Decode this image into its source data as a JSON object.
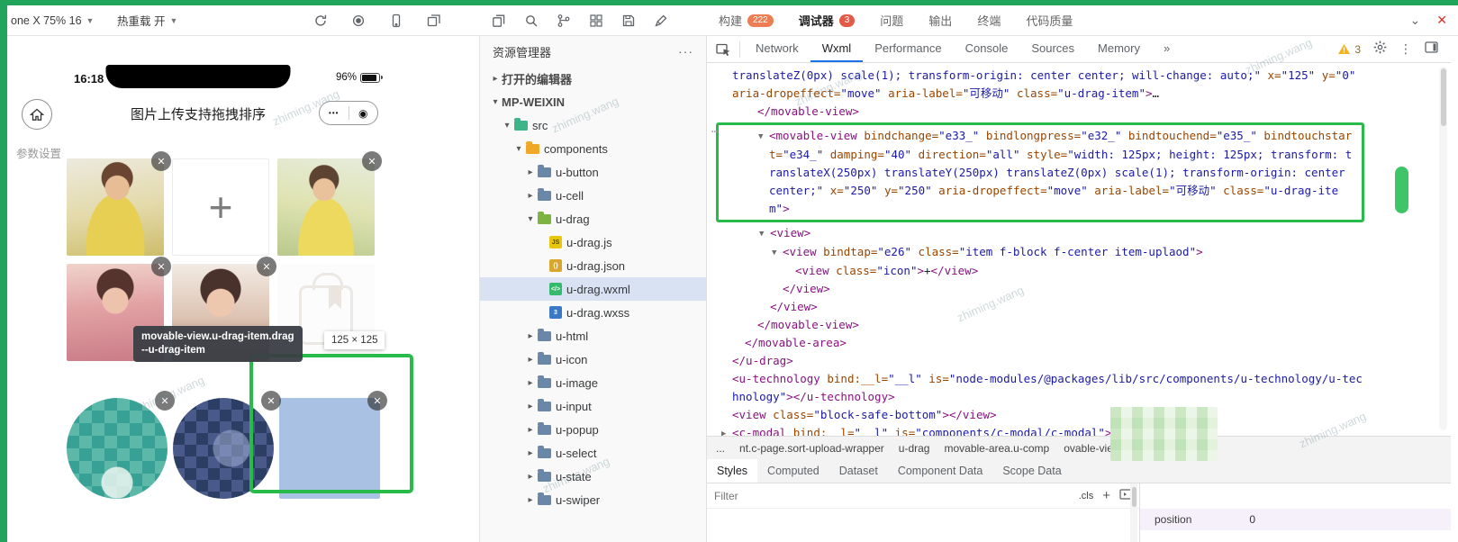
{
  "window_controls": {
    "collapse_glyph": "⌄",
    "close_glyph": "✕"
  },
  "toolbar": {
    "device_selector": "one X 75% 16",
    "hot_reload_label": "热重载 开",
    "icons_group_a": [
      "refresh",
      "record",
      "phone",
      "new-window"
    ],
    "icons_group_b": [
      "copy",
      "search",
      "branch",
      "grid",
      "save",
      "brush"
    ],
    "tabs": [
      {
        "label": "构建",
        "badge": "222",
        "active": false
      },
      {
        "label": "调试器",
        "badge": "3",
        "active": true
      },
      {
        "label": "问题",
        "badge": "",
        "active": false
      },
      {
        "label": "输出",
        "badge": "",
        "active": false
      },
      {
        "label": "终端",
        "badge": "",
        "active": false
      },
      {
        "label": "代码质量",
        "badge": "",
        "active": false
      }
    ]
  },
  "simulator": {
    "status_time": "16:18",
    "battery_percent": "96%",
    "nav_title": "图片上传支持拖拽排序",
    "capsule_more": "•••",
    "capsule_record": "◉",
    "section_label": "参数设置",
    "plus_glyph": "+",
    "close_glyph": "✕",
    "tooltip_line1": "movable-view.u-drag-item.drag",
    "tooltip_line2": "--u-drag-item",
    "size_chip": "125 × 125",
    "grid": [
      {
        "kind": "ph1",
        "close": true
      },
      {
        "kind": "plus",
        "close": false
      },
      {
        "kind": "ph2",
        "close": true
      },
      {
        "kind": "ph3",
        "close": true
      },
      {
        "kind": "ph4",
        "close": true
      },
      {
        "kind": "ghost",
        "close": false
      }
    ],
    "bottom_row": [
      {
        "kind": "mosaic-teal",
        "shape": "circle",
        "close": true
      },
      {
        "kind": "mosaic-navy",
        "shape": "circle",
        "close": true
      },
      {
        "kind": "plain-blue",
        "shape": "square",
        "close": true
      }
    ]
  },
  "explorer": {
    "title": "资源管理器",
    "actions_label": "···",
    "tree": [
      {
        "label": "打开的编辑器",
        "depth": 0,
        "arrow": "right",
        "bold": true
      },
      {
        "label": "MP-WEIXIN",
        "depth": 0,
        "arrow": "down",
        "bold": true
      },
      {
        "label": "src",
        "depth": 1,
        "arrow": "down",
        "icon": "folder-src"
      },
      {
        "label": "components",
        "depth": 2,
        "arrow": "down",
        "icon": "folder-components"
      },
      {
        "label": "u-button",
        "depth": 3,
        "arrow": "right",
        "icon": "folder"
      },
      {
        "label": "u-cell",
        "depth": 3,
        "arrow": "right",
        "icon": "folder"
      },
      {
        "label": "u-drag",
        "depth": 3,
        "arrow": "down",
        "icon": "folder-open"
      },
      {
        "label": "u-drag.js",
        "depth": 4,
        "icon": "js"
      },
      {
        "label": "u-drag.json",
        "depth": 4,
        "icon": "json"
      },
      {
        "label": "u-drag.wxml",
        "depth": 4,
        "icon": "wxml",
        "selected": true
      },
      {
        "label": "u-drag.wxss",
        "depth": 4,
        "icon": "wxss"
      },
      {
        "label": "u-html",
        "depth": 3,
        "arrow": "right",
        "icon": "folder"
      },
      {
        "label": "u-icon",
        "depth": 3,
        "arrow": "right",
        "icon": "folder"
      },
      {
        "label": "u-image",
        "depth": 3,
        "arrow": "right",
        "icon": "folder"
      },
      {
        "label": "u-input",
        "depth": 3,
        "arrow": "right",
        "icon": "folder"
      },
      {
        "label": "u-popup",
        "depth": 3,
        "arrow": "right",
        "icon": "folder"
      },
      {
        "label": "u-select",
        "depth": 3,
        "arrow": "right",
        "icon": "folder"
      },
      {
        "label": "u-state",
        "depth": 3,
        "arrow": "right",
        "icon": "folder"
      },
      {
        "label": "u-swiper",
        "depth": 3,
        "arrow": "right",
        "icon": "folder"
      }
    ]
  },
  "devtools": {
    "tabs": [
      {
        "label": "Network",
        "active": false
      },
      {
        "label": "Wxml",
        "active": true
      },
      {
        "label": "Performance",
        "active": false
      },
      {
        "label": "Console",
        "active": false
      },
      {
        "label": "Sources",
        "active": false
      },
      {
        "label": "Memory",
        "active": false
      },
      {
        "label": "»",
        "active": false
      }
    ],
    "warning_count": "3",
    "code_blocks": [
      {
        "highlight": false,
        "lines": [
          {
            "d": 0,
            "seg": [
              [
                "v",
                "translateZ(0px) scale(1); transform-origin: center center; will-change: auto;\""
              ],
              [
                "at",
                " x="
              ],
              [
                "v",
                "\"125\""
              ],
              [
                "at",
                " y="
              ],
              [
                "v",
                "\"0\""
              ],
              [
                "at",
                " aria-dropeffect="
              ],
              [
                "v",
                "\"move\""
              ],
              [
                "at",
                " aria-label="
              ],
              [
                "v",
                "\"可移动\""
              ],
              [
                "at",
                " class="
              ],
              [
                "v",
                "\"u-drag-item\""
              ],
              [
                "t",
                ">"
              ],
              [
                "p",
                "…"
              ]
            ]
          },
          {
            "d": 2,
            "seg": [
              [
                "t",
                "</movable-view>"
              ]
            ]
          }
        ]
      },
      {
        "highlight": true,
        "lines": [
          {
            "d": 2,
            "seg": [
              [
                "a",
                "▼"
              ],
              [
                "t",
                "<movable-view"
              ],
              [
                "at",
                " bindchange="
              ],
              [
                "v",
                "\"e33_\""
              ],
              [
                "at",
                " bindlongpress="
              ],
              [
                "v",
                "\"e32_\""
              ],
              [
                "at",
                " bindtouchend="
              ],
              [
                "v",
                "\"e35_\""
              ],
              [
                "at",
                " bindtouchstart="
              ],
              [
                "v",
                "\"e34_\""
              ],
              [
                "at",
                " damping="
              ],
              [
                "v",
                "\"40\""
              ],
              [
                "at",
                " direction="
              ],
              [
                "v",
                "\"all\""
              ],
              [
                "at",
                " style="
              ],
              [
                "v",
                "\"width: 125px; height: 125px; transform: translateX(250px) translateY(250px) translateZ(0px) scale(1); transform-origin: center center;\""
              ],
              [
                "at",
                " x="
              ],
              [
                "v",
                "\"250\""
              ],
              [
                "at",
                " y="
              ],
              [
                "v",
                "\"250\""
              ],
              [
                "at",
                " aria-dropeffect="
              ],
              [
                "v",
                "\"move\""
              ],
              [
                "at",
                " aria-label="
              ],
              [
                "v",
                "\"可移动\""
              ],
              [
                "at",
                " class="
              ],
              [
                "v",
                "\"u-drag-item\""
              ],
              [
                "t",
                ">"
              ]
            ]
          }
        ]
      },
      {
        "highlight": false,
        "lines": [
          {
            "d": 3,
            "seg": [
              [
                "a",
                "▼"
              ],
              [
                "t",
                "<view>"
              ]
            ]
          },
          {
            "d": 4,
            "seg": [
              [
                "a",
                "▼"
              ],
              [
                "t",
                "<view"
              ],
              [
                "at",
                " bindtap="
              ],
              [
                "v",
                "\"e26\""
              ],
              [
                "at",
                " class="
              ],
              [
                "v",
                "\"item f-block f-center item-uplaod\""
              ],
              [
                "t",
                ">"
              ]
            ]
          },
          {
            "d": 5,
            "seg": [
              [
                "t",
                "<view"
              ],
              [
                "at",
                " class="
              ],
              [
                "v",
                "\"icon\""
              ],
              [
                "t",
                ">"
              ],
              [
                "p",
                "+"
              ],
              [
                "t",
                "</view>"
              ]
            ]
          },
          {
            "d": 4,
            "seg": [
              [
                "t",
                "</view>"
              ]
            ]
          },
          {
            "d": 3,
            "seg": [
              [
                "t",
                "</view>"
              ]
            ]
          },
          {
            "d": 2,
            "seg": [
              [
                "t",
                "</movable-view>"
              ]
            ]
          },
          {
            "d": 1,
            "seg": [
              [
                "t",
                "</movable-area>"
              ]
            ]
          },
          {
            "d": 0,
            "seg": [
              [
                "t",
                "</u-drag>"
              ]
            ]
          },
          {
            "d": 0,
            "seg": [
              [
                "t",
                "<u-technology"
              ],
              [
                "at",
                " bind:__l="
              ],
              [
                "v",
                "\"__l\""
              ],
              [
                "at",
                " is="
              ],
              [
                "v",
                "\"node-modules/@packages/lib/src/components/u-technology/u-technology\""
              ],
              [
                "t",
                "></u-technology>"
              ]
            ]
          },
          {
            "d": 0,
            "seg": [
              [
                "t",
                "<view"
              ],
              [
                "at",
                " class="
              ],
              [
                "v",
                "\"block-safe-bottom\""
              ],
              [
                "t",
                "></view>"
              ]
            ]
          },
          {
            "d": 0,
            "seg": [
              [
                "a",
                "▶"
              ],
              [
                "t",
                "<c-modal"
              ],
              [
                "at",
                " bind:__l="
              ],
              [
                "v",
                "\"__l\""
              ],
              [
                "at",
                " is="
              ],
              [
                "v",
                "\"components/c-modal/c-modal\""
              ],
              [
                "t",
                ">"
              ],
              [
                "p",
                " "
              ],
              [
                "t",
                "</c-modal>"
              ]
            ]
          }
        ]
      }
    ],
    "breadcrumbs": [
      "...",
      "nt.c-page.sort-upload-wrapper",
      "u-drag",
      "movable-area.u-comp",
      "ovable-view.u-drag-item"
    ],
    "styles_tabs": [
      {
        "label": "Styles",
        "active": true
      },
      {
        "label": "Computed",
        "active": false
      },
      {
        "label": "Dataset",
        "active": false
      },
      {
        "label": "Component Data",
        "active": false
      },
      {
        "label": "Scope Data",
        "active": false
      }
    ],
    "filter_placeholder": "Filter",
    "cls_label": ".cls",
    "plus_label": "+",
    "layout_pane": {
      "rows": [
        {
          "label": "position",
          "value": "0"
        }
      ]
    }
  },
  "watermark": {
    "text": "zhiming.wang"
  }
}
